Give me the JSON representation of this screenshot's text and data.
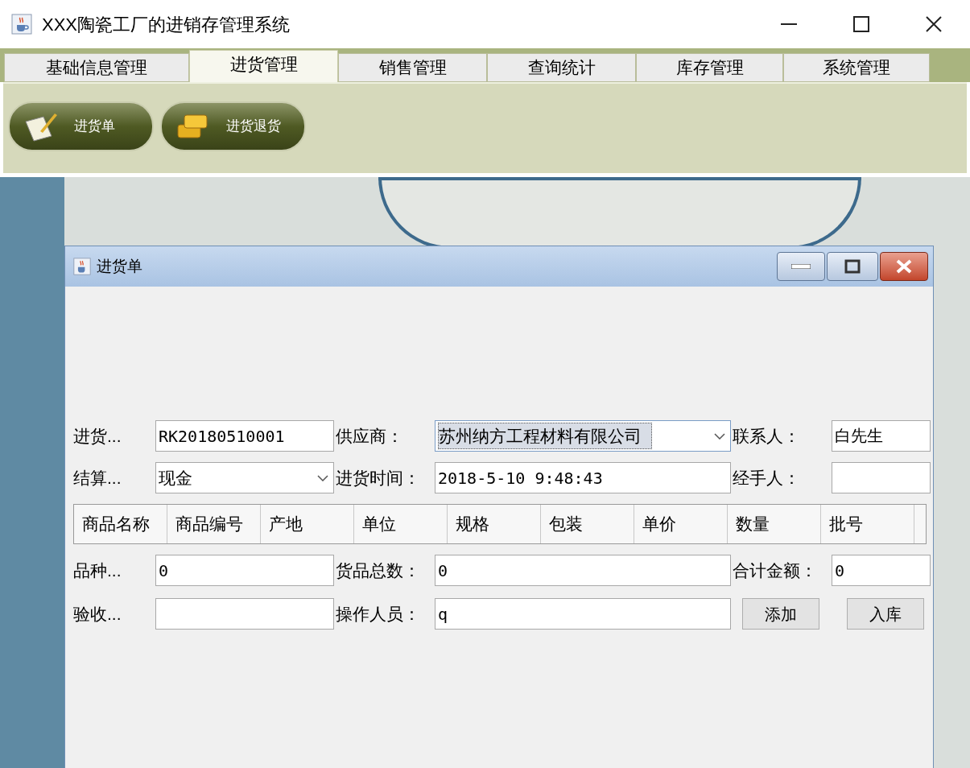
{
  "window": {
    "title": "XXX陶瓷工厂的进销存管理系统"
  },
  "tabs": [
    {
      "label": "基础信息管理",
      "selected": false
    },
    {
      "label": "进货管理",
      "selected": true
    },
    {
      "label": "销售管理",
      "selected": false
    },
    {
      "label": "查询统计",
      "selected": false
    },
    {
      "label": "库存管理",
      "selected": false
    },
    {
      "label": "系统管理",
      "selected": false
    }
  ],
  "toolbar": [
    {
      "label": "进货单",
      "kind": "order"
    },
    {
      "label": "进货退货",
      "kind": "return"
    }
  ],
  "dialog": {
    "title": "进货单",
    "rows": [
      [
        {
          "kind": "label",
          "text": "进货..."
        },
        {
          "kind": "input",
          "value": "RK20180510001"
        },
        {
          "kind": "label",
          "text": "供应商："
        },
        {
          "kind": "combo",
          "value": "苏州纳方工程材料有限公司",
          "focused": true
        },
        {
          "kind": "label",
          "text": "联系人："
        },
        {
          "kind": "input",
          "value": "白先生"
        }
      ],
      [
        {
          "kind": "label",
          "text": "结算..."
        },
        {
          "kind": "combo",
          "value": "现金",
          "focused": false
        },
        {
          "kind": "label",
          "text": "进货时间："
        },
        {
          "kind": "input",
          "value": "2018-5-10 9:48:43"
        },
        {
          "kind": "label",
          "text": "经手人："
        },
        {
          "kind": "input"
        }
      ],
      [
        {
          "kind": "table"
        }
      ],
      [
        {
          "kind": "label",
          "text": "品种..."
        },
        {
          "kind": "input",
          "value": "0"
        },
        {
          "kind": "label",
          "text": "货品总数："
        },
        {
          "kind": "input",
          "value": "0"
        },
        {
          "kind": "label",
          "text": "合计金额："
        },
        {
          "kind": "input",
          "value": "0"
        }
      ],
      [
        {
          "kind": "label",
          "text": "验收..."
        },
        {
          "kind": "input"
        },
        {
          "kind": "label",
          "text": "操作人员："
        },
        {
          "kind": "input",
          "value": "q"
        },
        {
          "kind": "button",
          "text": "添加"
        },
        {
          "kind": "button",
          "text": "入库"
        }
      ]
    ],
    "table": {
      "columns": [
        "商品名称",
        "商品编号",
        "产地",
        "单位",
        "规格",
        "包装",
        "单价",
        "数量",
        "批号"
      ]
    }
  }
}
